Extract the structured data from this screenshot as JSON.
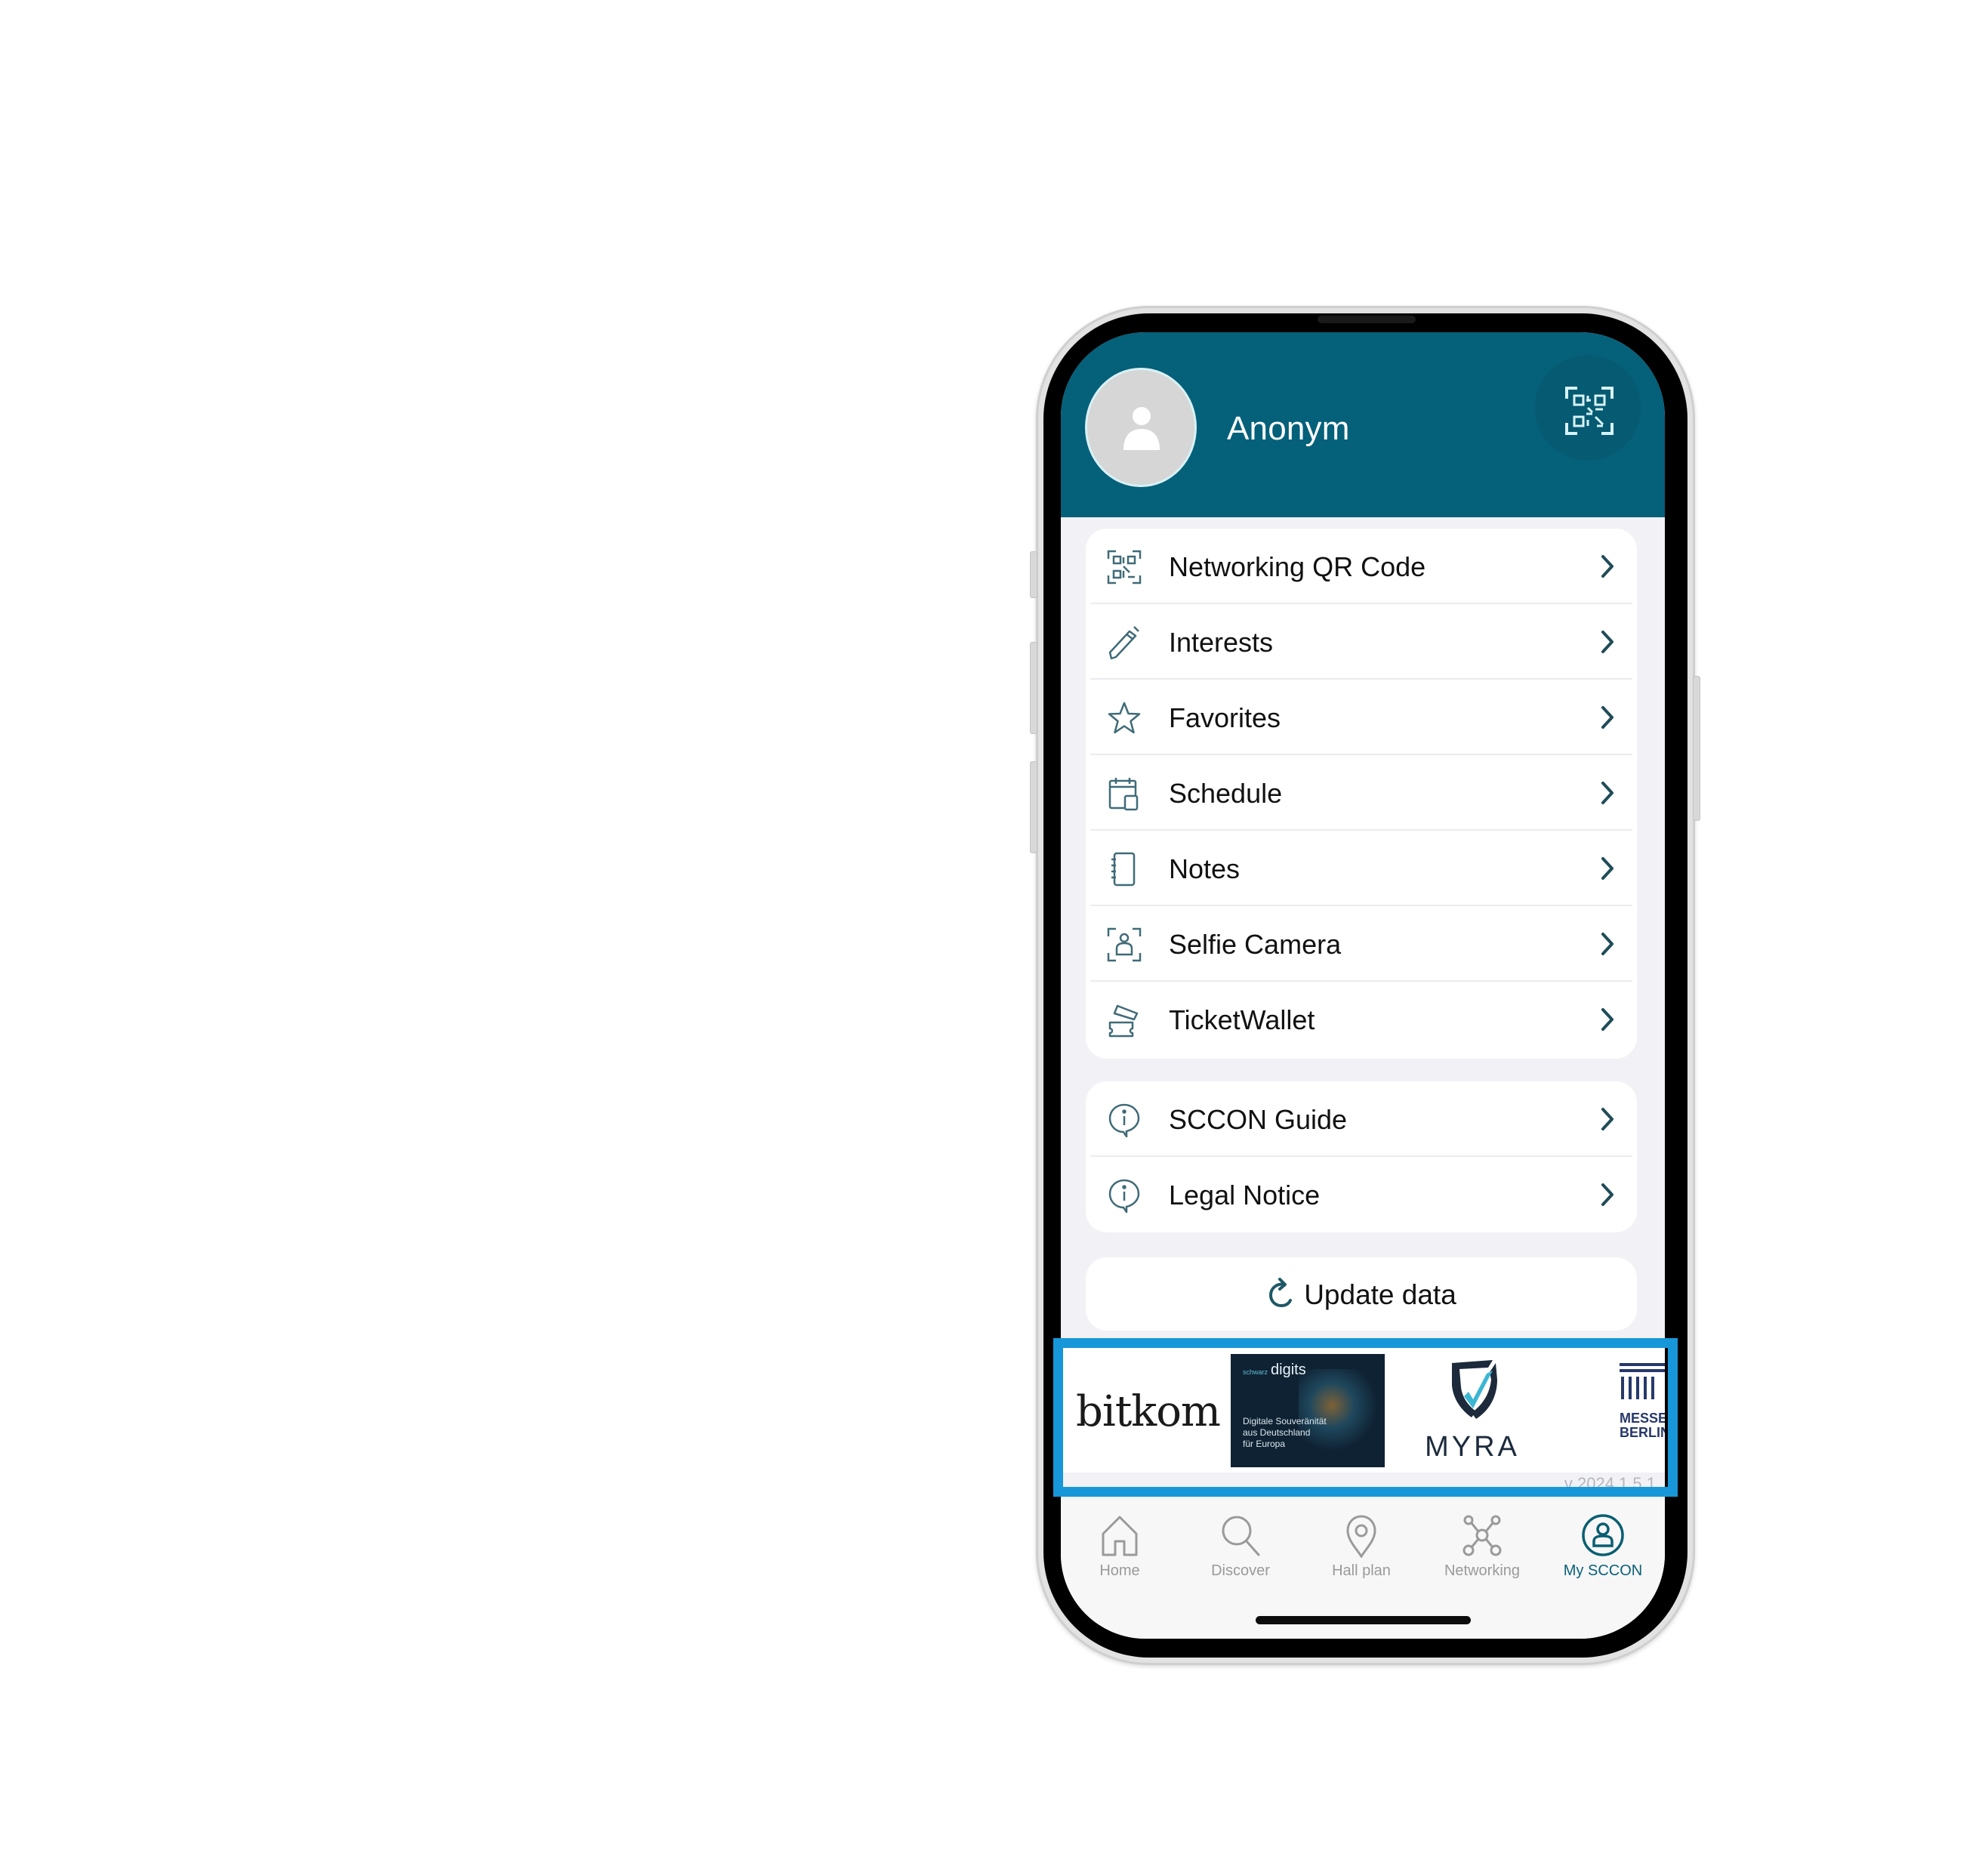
{
  "header": {
    "user_name": "Anonym",
    "avatar_icon": "person-icon",
    "qr_button_icon": "qr-code-icon"
  },
  "menu_primary": [
    {
      "label": "Networking QR Code",
      "icon": "qr-code-icon"
    },
    {
      "label": "Interests",
      "icon": "pencil-icon"
    },
    {
      "label": "Favorites",
      "icon": "star-icon"
    },
    {
      "label": "Schedule",
      "icon": "calendar-icon"
    },
    {
      "label": "Notes",
      "icon": "notebook-icon"
    },
    {
      "label": "Selfie Camera",
      "icon": "selfie-camera-icon"
    },
    {
      "label": "TicketWallet",
      "icon": "ticket-icon"
    }
  ],
  "menu_secondary": [
    {
      "label": "SCCON Guide",
      "icon": "info-bubble-icon"
    },
    {
      "label": "Legal Notice",
      "icon": "info-bubble-icon"
    }
  ],
  "update_button": {
    "label": "Update data",
    "icon": "refresh-icon"
  },
  "sponsors": {
    "bitkom": "bitkom",
    "digits_brand_prefix": "schwarz",
    "digits_brand": "digits",
    "digits_claim": [
      "Digitale Souveränität",
      "aus Deutschland",
      "für Europa"
    ],
    "myra": "MYRA",
    "messe": [
      "MESSE",
      "BERLIN"
    ]
  },
  "version": "v 2024.1.5.1",
  "tabs": [
    {
      "label": "Home",
      "icon": "home-icon",
      "active": false
    },
    {
      "label": "Discover",
      "icon": "search-icon",
      "active": false
    },
    {
      "label": "Hall plan",
      "icon": "map-pin-icon",
      "active": false
    },
    {
      "label": "Networking",
      "icon": "network-icon",
      "active": false
    },
    {
      "label": "My SCCON",
      "icon": "user-circle-icon",
      "active": true
    }
  ],
  "colors": {
    "header": "#05607a",
    "accent": "#0a6078",
    "highlight": "#1797d9",
    "icon": "#2d5d69"
  }
}
